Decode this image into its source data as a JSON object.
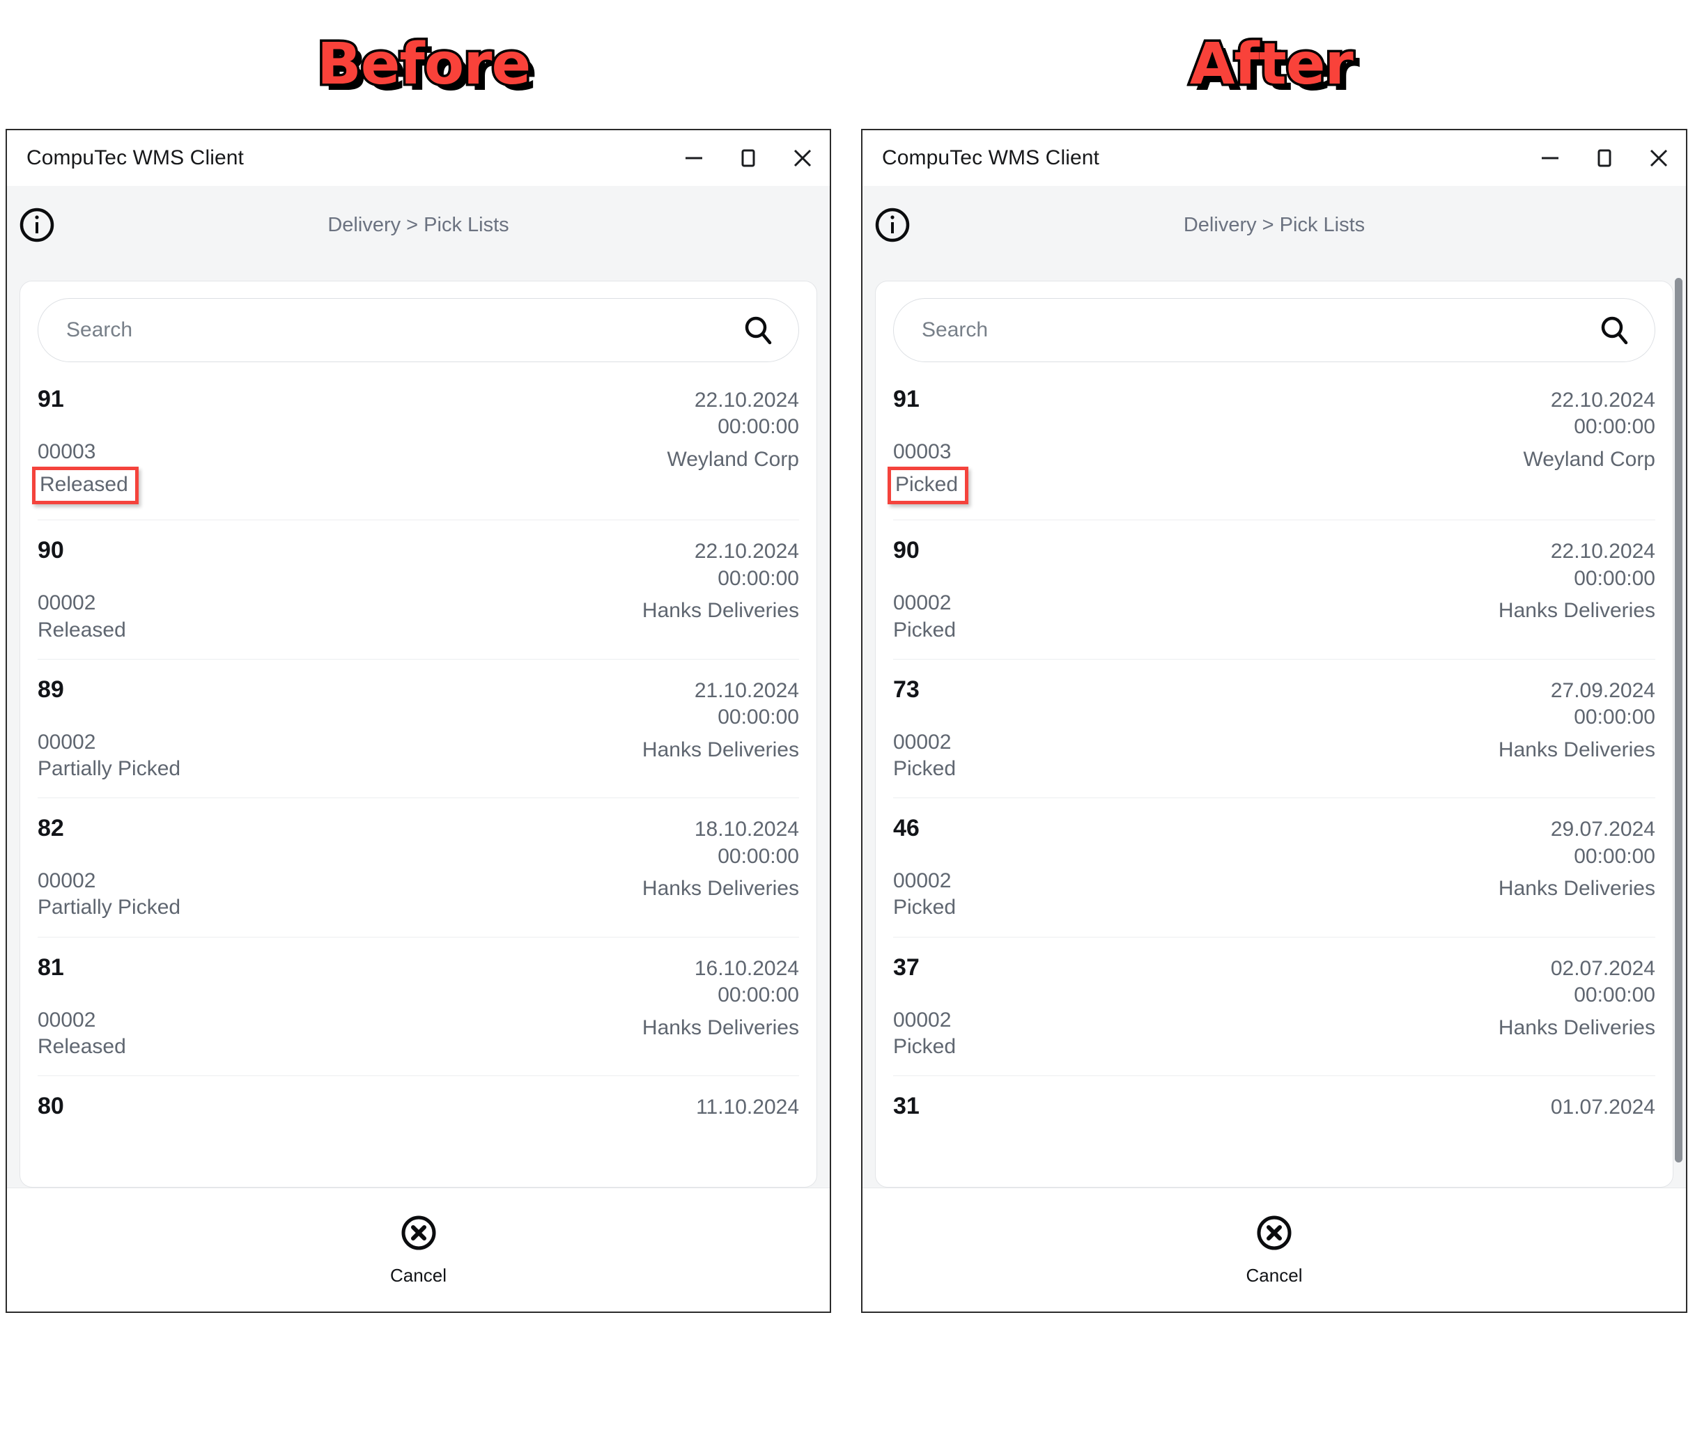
{
  "comparison": {
    "before_label": "Before",
    "after_label": "After",
    "highlight_color": "#F4433C"
  },
  "before": {
    "window": {
      "title": "CompuTec WMS Client",
      "minimize_icon": "minimize-icon",
      "maximize_icon": "maximize-icon",
      "close_icon": "close-icon"
    },
    "header": {
      "info_icon": "info-icon",
      "breadcrumb": "Delivery > Pick Lists"
    },
    "search": {
      "placeholder": "Search",
      "value": "",
      "icon": "search-icon"
    },
    "rows": [
      {
        "id": "91",
        "code": "00003",
        "status": "Released",
        "date": "22.10.2024",
        "time": "00:00:00",
        "customer": "Weyland Corp",
        "highlight": true
      },
      {
        "id": "90",
        "code": "00002",
        "status": "Released",
        "date": "22.10.2024",
        "time": "00:00:00",
        "customer": "Hanks Deliveries",
        "highlight": false
      },
      {
        "id": "89",
        "code": "00002",
        "status": "Partially Picked",
        "date": "21.10.2024",
        "time": "00:00:00",
        "customer": "Hanks Deliveries",
        "highlight": false
      },
      {
        "id": "82",
        "code": "00002",
        "status": "Partially Picked",
        "date": "18.10.2024",
        "time": "00:00:00",
        "customer": "Hanks Deliveries",
        "highlight": false
      },
      {
        "id": "81",
        "code": "00002",
        "status": "Released",
        "date": "16.10.2024",
        "time": "00:00:00",
        "customer": "Hanks Deliveries",
        "highlight": false
      },
      {
        "id": "80",
        "code": "",
        "status": "",
        "date": "11.10.2024",
        "time": "",
        "customer": "",
        "highlight": false
      }
    ],
    "footer": {
      "cancel_label": "Cancel",
      "cancel_icon": "cancel-circle-x-icon"
    },
    "scrollbar_visible": false
  },
  "after": {
    "window": {
      "title": "CompuTec WMS Client",
      "minimize_icon": "minimize-icon",
      "maximize_icon": "maximize-icon",
      "close_icon": "close-icon"
    },
    "header": {
      "info_icon": "info-icon",
      "breadcrumb": "Delivery > Pick Lists"
    },
    "search": {
      "placeholder": "Search",
      "value": "",
      "icon": "search-icon"
    },
    "rows": [
      {
        "id": "91",
        "code": "00003",
        "status": "Picked",
        "date": "22.10.2024",
        "time": "00:00:00",
        "customer": "Weyland Corp",
        "highlight": true
      },
      {
        "id": "90",
        "code": "00002",
        "status": "Picked",
        "date": "22.10.2024",
        "time": "00:00:00",
        "customer": "Hanks Deliveries",
        "highlight": false
      },
      {
        "id": "73",
        "code": "00002",
        "status": "Picked",
        "date": "27.09.2024",
        "time": "00:00:00",
        "customer": "Hanks Deliveries",
        "highlight": false
      },
      {
        "id": "46",
        "code": "00002",
        "status": "Picked",
        "date": "29.07.2024",
        "time": "00:00:00",
        "customer": "Hanks Deliveries",
        "highlight": false
      },
      {
        "id": "37",
        "code": "00002",
        "status": "Picked",
        "date": "02.07.2024",
        "time": "00:00:00",
        "customer": "Hanks Deliveries",
        "highlight": false
      },
      {
        "id": "31",
        "code": "",
        "status": "",
        "date": "01.07.2024",
        "time": "",
        "customer": "",
        "highlight": false
      }
    ],
    "footer": {
      "cancel_label": "Cancel",
      "cancel_icon": "cancel-circle-x-icon"
    },
    "scrollbar_visible": true
  }
}
